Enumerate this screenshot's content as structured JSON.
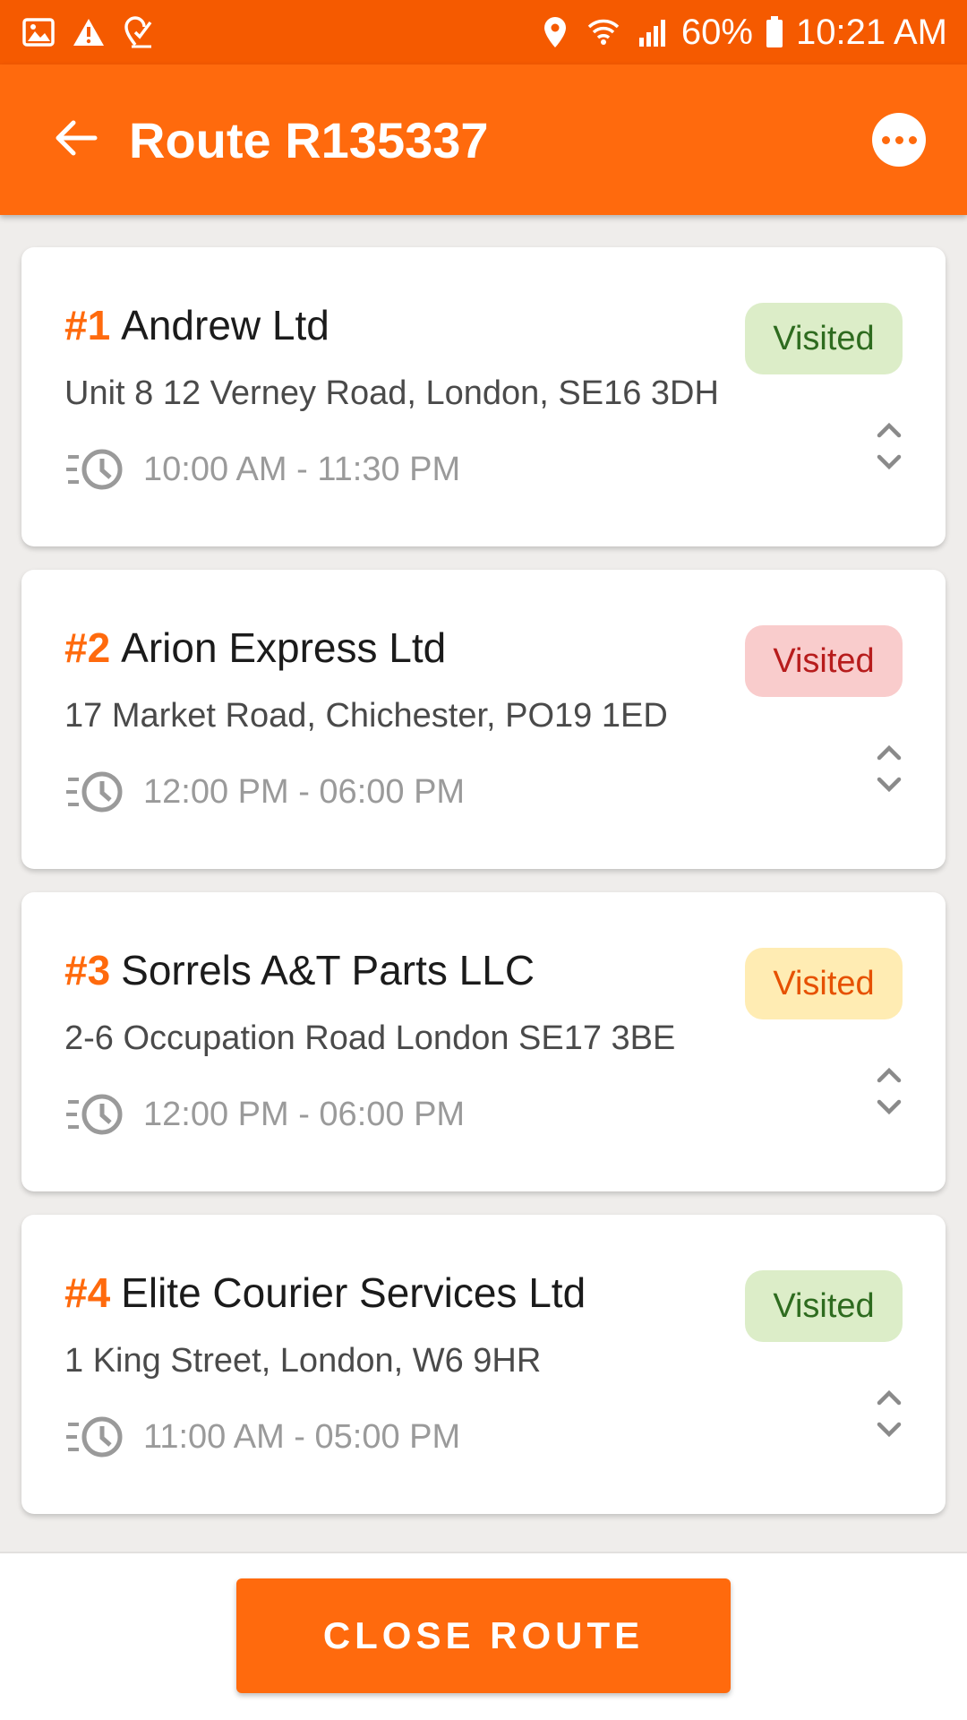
{
  "status_bar": {
    "battery": "60%",
    "time": "10:21 AM"
  },
  "header": {
    "title": "Route R135337"
  },
  "stops": [
    {
      "number": "#1",
      "name": "Andrew Ltd",
      "address": "Unit 8 12 Verney Road, London, SE16 3DH",
      "time_window": "10:00 AM - 11:30 PM",
      "status": "Visited",
      "badge_bg": "#dcedc8",
      "badge_fg": "#2e6b1f"
    },
    {
      "number": "#2",
      "name": "Arion Express Ltd",
      "address": "17 Market Road, Chichester, PO19 1ED",
      "time_window": "12:00 PM - 06:00 PM",
      "status": "Visited",
      "badge_bg": "#f9cccc",
      "badge_fg": "#b71c1c"
    },
    {
      "number": "#3",
      "name": "Sorrels A&T Parts LLC",
      "address": "2-6 Occupation Road London SE17 3BE",
      "time_window": "12:00 PM - 06:00 PM",
      "status": "Visited",
      "badge_bg": "#ffecb3",
      "badge_fg": "#e65100"
    },
    {
      "number": "#4",
      "name": "Elite Courier Services Ltd",
      "address": "1 King Street, London, W6 9HR",
      "time_window": "11:00 AM - 05:00 PM",
      "status": "Visited",
      "badge_bg": "#dcedc8",
      "badge_fg": "#2e6b1f"
    }
  ],
  "footer": {
    "close_button_label": "CLOSE ROUTE"
  },
  "colors": {
    "accent": "#ff6a0d",
    "status_bar": "#f55a00"
  },
  "icons": {
    "status_left": [
      "image-icon",
      "warning-icon",
      "location-check-icon"
    ],
    "status_right": [
      "location-pin-icon",
      "wifi-icon",
      "signal-icon",
      "battery-icon"
    ],
    "header": [
      "back-arrow-icon",
      "more-options-icon"
    ],
    "card": [
      "time-window-icon",
      "expand-chevron-icon"
    ]
  }
}
